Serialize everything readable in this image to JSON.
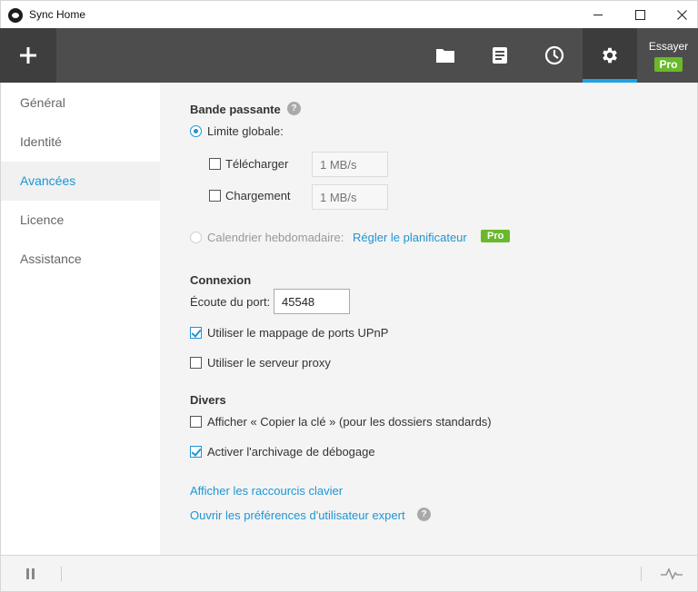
{
  "window": {
    "title": "Sync Home"
  },
  "toolbar": {
    "try_label": "Essayer",
    "pro_label": "Pro",
    "accent": "#1ea2e6"
  },
  "sidebar": {
    "items": [
      {
        "label": "Général"
      },
      {
        "label": "Identité"
      },
      {
        "label": "Avancées",
        "active": true
      },
      {
        "label": "Licence"
      },
      {
        "label": "Assistance"
      }
    ]
  },
  "bandwidth": {
    "title": "Bande passante",
    "help": "?",
    "global_limit_label": "Limite globale:",
    "download_label": "Télécharger",
    "download_placeholder": "1 MB/s",
    "upload_label": "Chargement",
    "upload_placeholder": "1 MB/s",
    "schedule_label": "Calendrier hebdomadaire:",
    "schedule_link": "Régler le planificateur",
    "pro_tag": "Pro"
  },
  "connection": {
    "title": "Connexion",
    "port_label": "Écoute du port:",
    "port_value": "45548",
    "upnp_label": "Utiliser le mappage de ports UPnP",
    "upnp_checked": true,
    "proxy_label": "Utiliser le serveur proxy",
    "proxy_checked": false
  },
  "misc": {
    "title": "Divers",
    "copy_key_label": "Afficher « Copier la clé » (pour les dossiers standards)",
    "copy_key_checked": false,
    "debug_label": "Activer l'archivage de débogage",
    "debug_checked": true
  },
  "links": {
    "shortcuts": "Afficher les raccourcis clavier",
    "expert_prefs": "Ouvrir les préférences d'utilisateur expert",
    "help": "?"
  },
  "colors": {
    "accent": "#1e95d4",
    "pro_green": "#6ab92b",
    "toolbar_bg": "#4d4d4d"
  }
}
